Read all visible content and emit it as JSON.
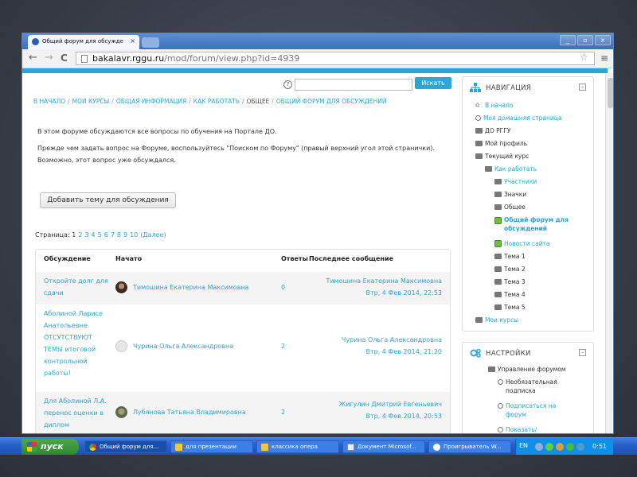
{
  "browser": {
    "tab_title": "Общий форум для обсужде",
    "tab_close": "×",
    "url_host": "bakalavr.rggu.ru",
    "url_path": "/mod/forum/view.php?id=4939",
    "back": "←",
    "forward": "→",
    "reload": "C",
    "star": "☆",
    "menu": "≡",
    "win_min": "_",
    "win_max": "▫",
    "win_close": "x"
  },
  "search": {
    "help": "?",
    "input_value": "",
    "button_label": "Искать"
  },
  "breadcrumb": {
    "items": [
      "В НАЧАЛО",
      "МОИ КУРСЫ",
      "ОБЩАЯ ИНФОРМАЦИЯ",
      "КАК РАБОТАТЬ",
      "ОБЩЕЕ",
      "ОБЩИЙ ФОРУМ ДЛЯ ОБСУЖДЕНИЙ"
    ],
    "sep": "/"
  },
  "intro": {
    "p1": "В этом форуме обсуждаются все вопросы по обучения на Портале ДО.",
    "p2": "Прежде чем задать вопрос на Форуме, воспользуйтесь \"Поиском по Форуму\" (правый верхний угол этой странички). Возможно, этот вопрос уже обсуждался."
  },
  "add_topic_label": "Добавить тему для обсуждения",
  "paging": {
    "label": "Страница:",
    "current": "1",
    "pages": [
      "2",
      "3",
      "4",
      "5",
      "6",
      "7",
      "8",
      "9",
      "10"
    ],
    "next": "(Далее)"
  },
  "table": {
    "headers": {
      "discussion": "Обсуждение",
      "started_by": "Начато",
      "replies": "Ответы",
      "last_post": "Последнее сообщение"
    },
    "rows": [
      {
        "discussion": "Откройте долг для сдачи",
        "author": "Тимошина Екатерина Максимовна",
        "replies": "0",
        "last_author": "Тимошина Екатерина Максимовна",
        "last_date": "Втр, 4 Фев 2014, 22:53"
      },
      {
        "discussion": "Аболиной Ларисе Анатольевне. ОТСУТСТВУЮТ ТЕМЫ итоговой контрольной работы!",
        "author": "Чурина Ольга Александровна",
        "replies": "2",
        "last_author": "Чурина Ольга Александровна",
        "last_date": "Втр, 4 Фев 2014, 21:20"
      },
      {
        "discussion": "Для Аболиной Л.А. перенос оценки в диплом",
        "author": "Лубянова Татьяна Владимировна",
        "replies": "2",
        "last_author": "Жигулин Дмитрий Евгеньевич",
        "last_date": "Втр, 4 Фев 2014, 20:53"
      }
    ]
  },
  "navigation": {
    "title": "НАВИГАЦИЯ",
    "collapse": "–",
    "home": "В начало",
    "my_home": "Моя домашняя страница",
    "do_rggu": "ДО РГГУ",
    "my_profile": "Мой профиль",
    "current_course": "Текущий курс",
    "how_to": "Как работать",
    "participants": "Участники",
    "badges": "Значки",
    "general": "Общее",
    "forum_line1": "Общий форум для",
    "forum_line2": "обсуждений",
    "site_news": "Новости сайта",
    "topics": [
      "Тема 1",
      "Тема 2",
      "Тема 3",
      "Тема 4",
      "Тема 5"
    ],
    "my_courses": "Мои курсы"
  },
  "settings": {
    "title": "НАСТРОЙКИ",
    "collapse": "–",
    "forum_admin": "Управление форумом",
    "optional_sub_1": "Необязательная",
    "optional_sub_2": "подписка",
    "subscribe_1": "Подписаться на",
    "subscribe_2": "форум",
    "show": "Показать/"
  },
  "taskbar": {
    "start": "пуск",
    "tasks": [
      "Общий форум для...",
      "для презентации",
      "классика опера",
      "Документ Microsof...",
      "Проигрыватель W..."
    ],
    "lang": "EN",
    "clock": "0:51"
  },
  "colors": {
    "accent": "#2ba6d6",
    "titlebar": "#3f6fb8",
    "taskbar": "#2660c8"
  }
}
